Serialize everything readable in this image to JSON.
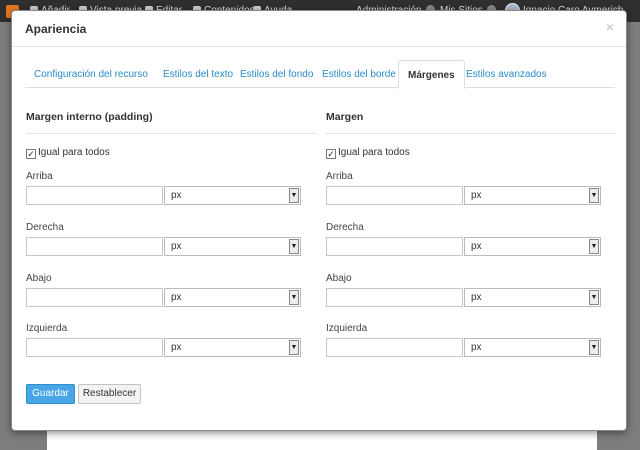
{
  "background": {
    "topbar_items": [
      "Añadir",
      "Vista previa",
      "Editar",
      "Contenidos",
      "Ayuda"
    ],
    "right_items": [
      "Administración",
      "Mis Sitios"
    ],
    "user_name": "Ignacio Caro Aymerich"
  },
  "modal": {
    "title": "Apariencia",
    "close_label": "×"
  },
  "tabs": [
    {
      "label": "Configuración del recurso"
    },
    {
      "label": "Estilos del texto"
    },
    {
      "label": "Estilos del fondo"
    },
    {
      "label": "Estilos del borde"
    },
    {
      "label": "Márgenes"
    },
    {
      "label": "Estilos avanzados"
    }
  ],
  "active_tab": "Márgenes",
  "padding": {
    "title": "Margen interno (padding)",
    "same_for_all_label": "Igual para todos",
    "same_for_all_checked": true,
    "fields": [
      {
        "label": "Arriba",
        "value": "",
        "unit": "px"
      },
      {
        "label": "Derecha",
        "value": "",
        "unit": "px"
      },
      {
        "label": "Abajo",
        "value": "",
        "unit": "px"
      },
      {
        "label": "Izquierda",
        "value": "",
        "unit": "px"
      }
    ]
  },
  "margin": {
    "title": "Margen",
    "same_for_all_label": "Igual para todos",
    "same_for_all_checked": true,
    "fields": [
      {
        "label": "Arriba",
        "value": "",
        "unit": "px"
      },
      {
        "label": "Derecha",
        "value": "",
        "unit": "px"
      },
      {
        "label": "Abajo",
        "value": "",
        "unit": "px"
      },
      {
        "label": "Izquierda",
        "value": "",
        "unit": "px"
      }
    ]
  },
  "buttons": {
    "save": "Guardar",
    "reset": "Restablecer"
  },
  "colors": {
    "accent": "#49a6e6",
    "tab_link": "#2a8bc8"
  }
}
